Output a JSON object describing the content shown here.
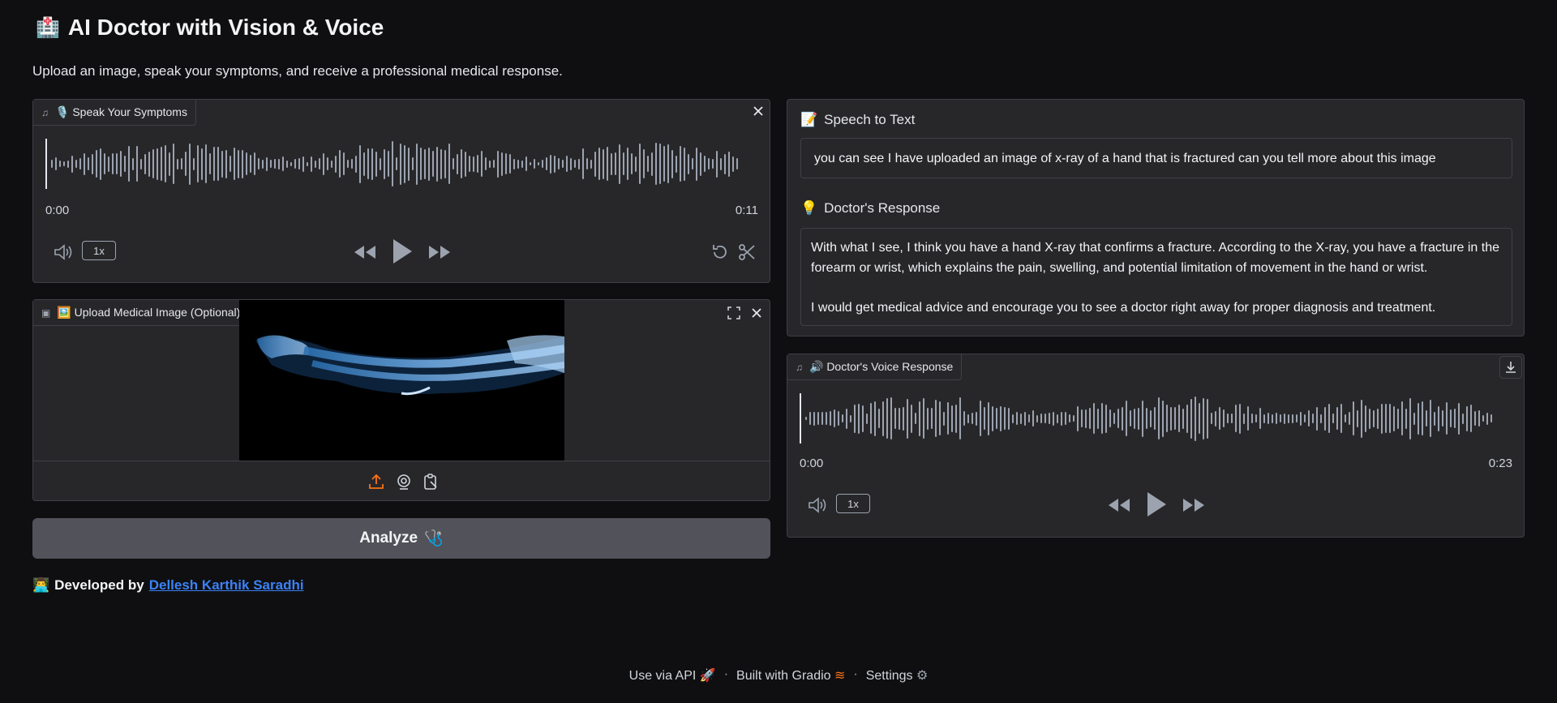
{
  "header": {
    "title_icon": "doctor-badge-emoji",
    "title": "AI Doctor with Vision & Voice",
    "subtitle": "Upload an image, speak your symptoms, and receive a professional medical response."
  },
  "audio_input": {
    "label_icon": "music-note-icon",
    "label": "🎙️ Speak Your Symptoms",
    "current_time": "0:00",
    "duration": "0:11",
    "playback_rate": "1x",
    "playback_position": 0.0
  },
  "image_input": {
    "label_icon": "image-icon",
    "label": "🖼️ Upload Medical Image (Optional)",
    "image_alt": "x-ray of forearm and hand"
  },
  "analyze_button": {
    "label": "Analyze",
    "icon": "🩺"
  },
  "developer": {
    "prefix": "Developed by",
    "name": "Dellesh Karthik Saradhi"
  },
  "speech_to_text": {
    "label": "Speech to Text",
    "label_icon": "📝",
    "value": "you can see I have uploaded an image of x-ray of a hand that is fractured can you tell more about this image"
  },
  "doctor_response": {
    "label": "Doctor's Response",
    "label_icon": "💡",
    "paragraph1": "With what I see, I think you have a hand X-ray that confirms a fracture. According to the X-ray, you have a fracture in the forearm or wrist, which explains the pain, swelling, and potential limitation of movement in the hand or wrist.",
    "paragraph2": "I would get medical advice and encourage you to see a doctor right away for proper diagnosis and treatment."
  },
  "voice_response": {
    "label_icon": "music-note-icon",
    "label": "🔊 Doctor's Voice Response",
    "current_time": "0:00",
    "duration": "0:23",
    "playback_rate": "1x"
  },
  "footer": {
    "api": "Use via API",
    "built": "Built with Gradio",
    "settings": "Settings",
    "separator": "·"
  },
  "colors": {
    "background": "#0f0f11",
    "panel": "#27272a",
    "accent_orange": "#f97316",
    "link_blue": "#3b82f6"
  }
}
